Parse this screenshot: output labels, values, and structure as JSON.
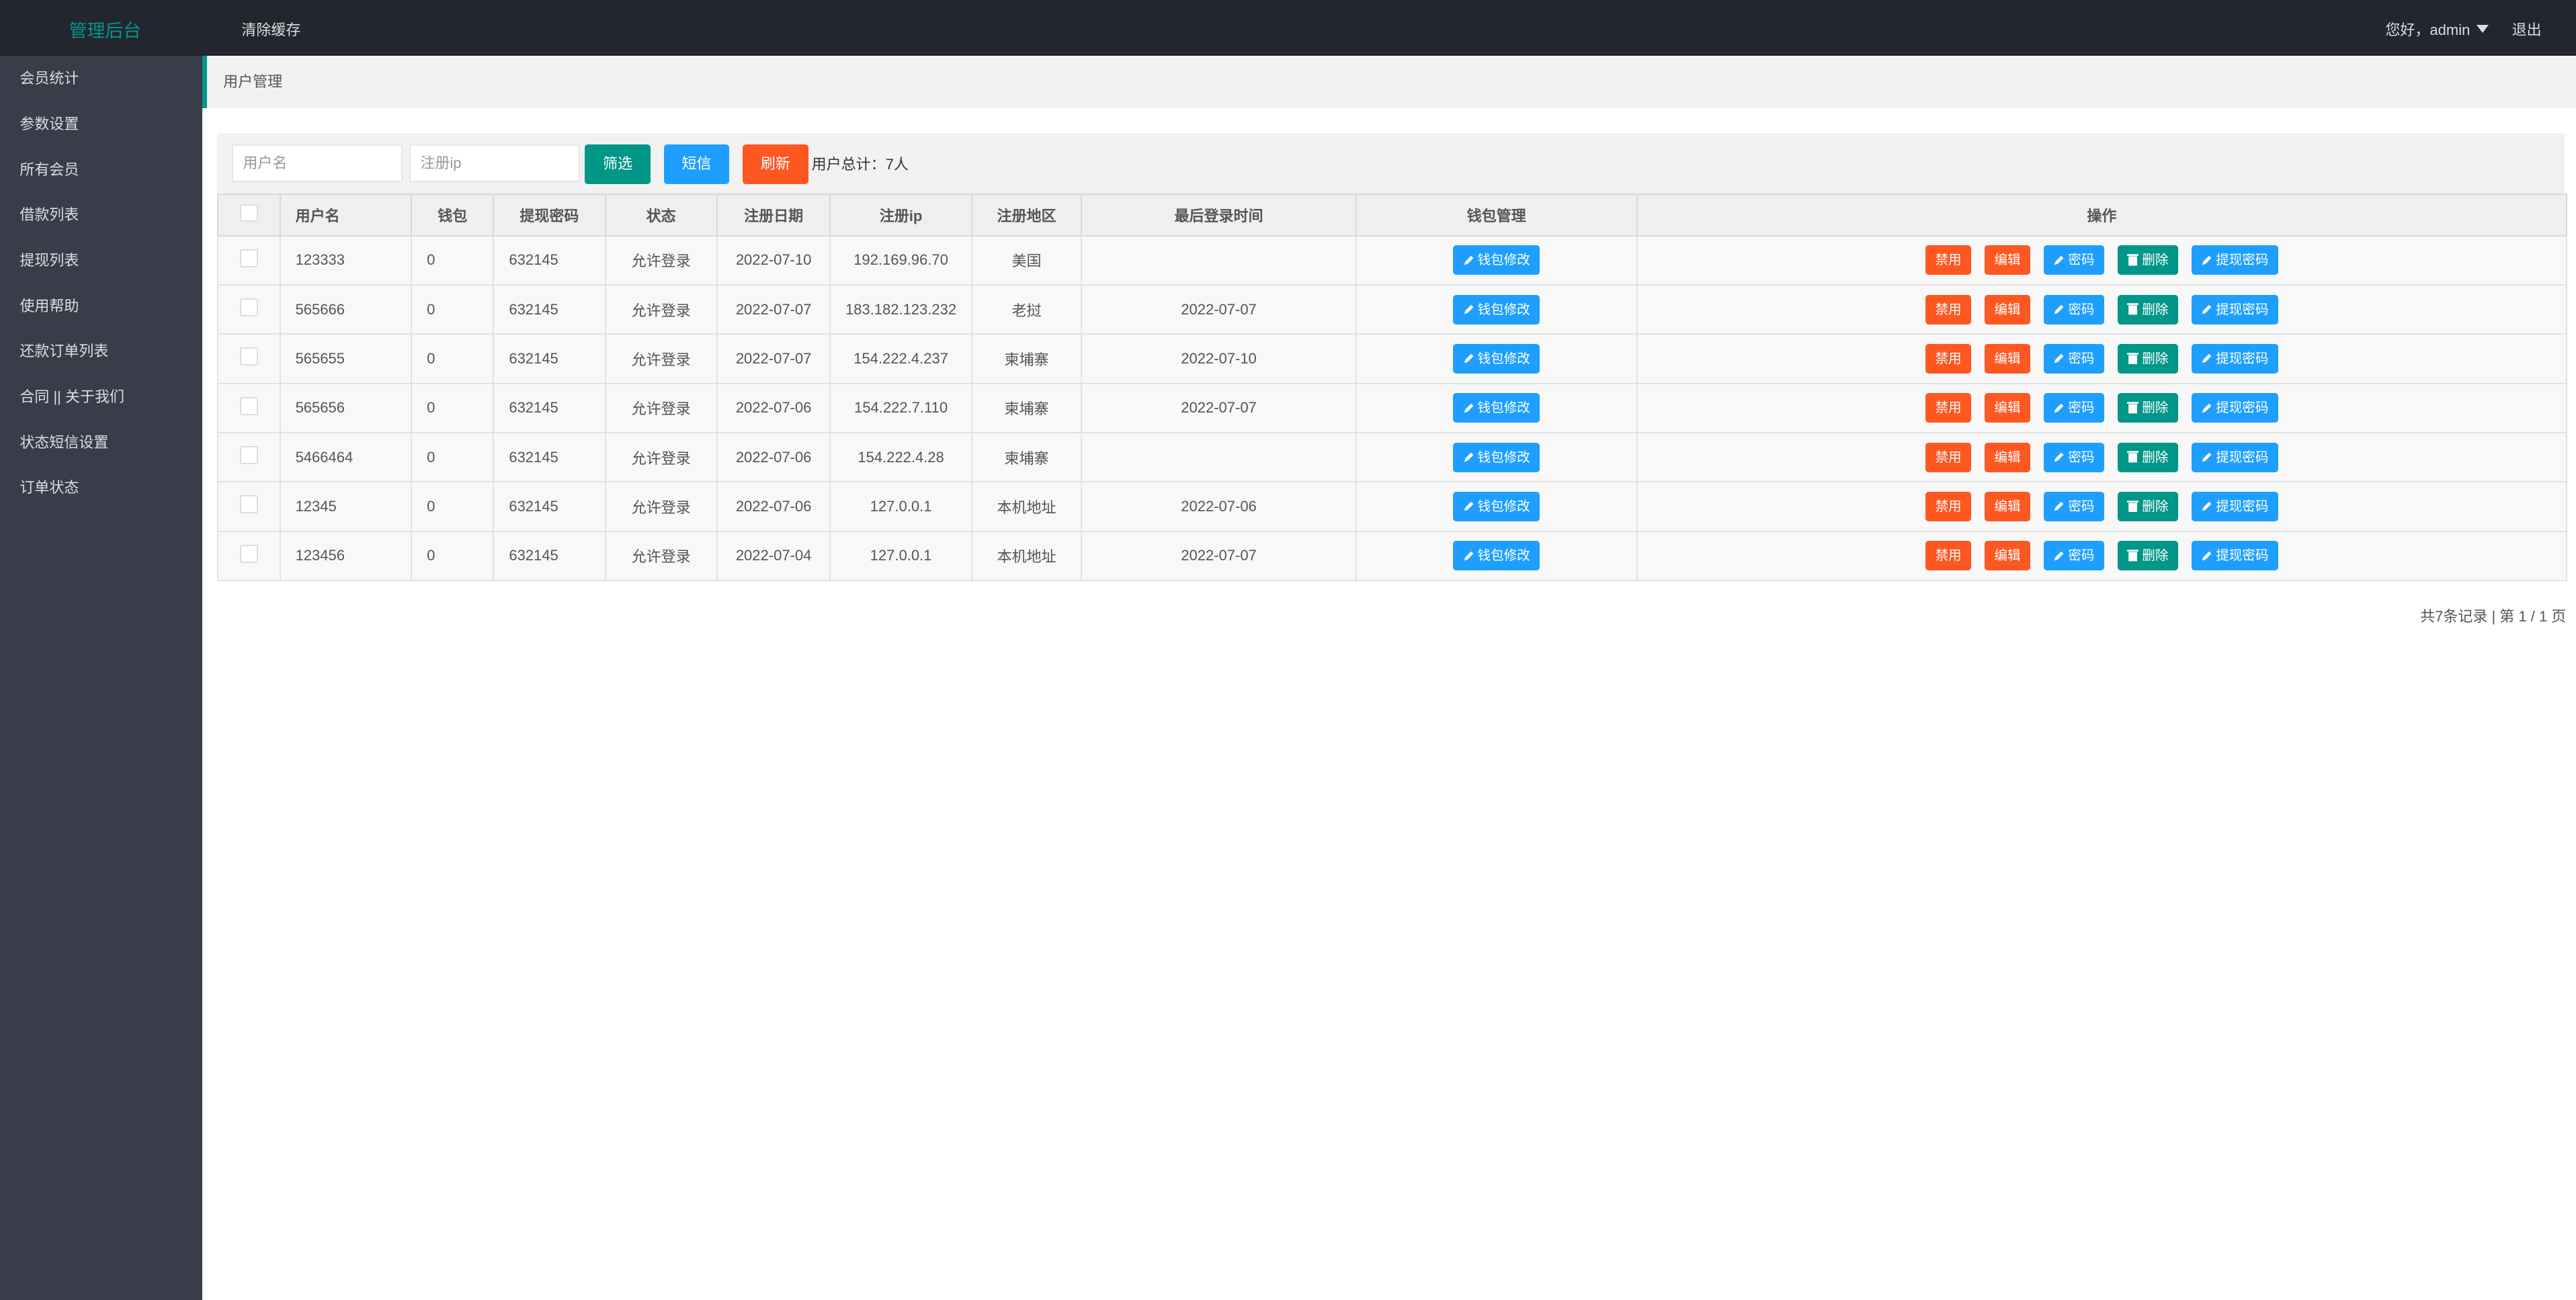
{
  "header": {
    "logo": "管理后台",
    "clear_cache": "清除缓存",
    "greeting": "您好，admin",
    "logout": "退出"
  },
  "sidebar": {
    "items": [
      "会员统计",
      "参数设置",
      "所有会员",
      "借款列表",
      "提现列表",
      "使用帮助",
      "还款订单列表",
      "合同 || 关于我们",
      "状态短信设置",
      "订单状态"
    ]
  },
  "breadcrumb": "用户管理",
  "toolbar": {
    "username_placeholder": "用户名",
    "ip_placeholder": "注册ip",
    "filter": "筛选",
    "sms": "短信",
    "refresh": "刷新",
    "total": "用户总计：7人"
  },
  "table": {
    "headers": [
      "用户名",
      "钱包",
      "提现密码",
      "状态",
      "注册日期",
      "注册ip",
      "注册地区",
      "最后登录时间",
      "钱包管理",
      "操作"
    ],
    "rows": [
      [
        "123333",
        "0",
        "632145",
        "允许登录",
        "2022-07-10",
        "192.169.96.70",
        "美国",
        ""
      ],
      [
        "565666",
        "0",
        "632145",
        "允许登录",
        "2022-07-07",
        "183.182.123.232",
        "老挝",
        "2022-07-07"
      ],
      [
        "565655",
        "0",
        "632145",
        "允许登录",
        "2022-07-07",
        "154.222.4.237",
        "柬埔寨",
        "2022-07-10"
      ],
      [
        "565656",
        "0",
        "632145",
        "允许登录",
        "2022-07-06",
        "154.222.7.110",
        "柬埔寨",
        "2022-07-07"
      ],
      [
        "5466464",
        "0",
        "632145",
        "允许登录",
        "2022-07-06",
        "154.222.4.28",
        "柬埔寨",
        ""
      ],
      [
        "12345",
        "0",
        "632145",
        "允许登录",
        "2022-07-06",
        "127.0.0.1",
        "本机地址",
        "2022-07-06"
      ],
      [
        "123456",
        "0",
        "632145",
        "允许登录",
        "2022-07-04",
        "127.0.0.1",
        "本机地址",
        "2022-07-07"
      ]
    ],
    "wallet_button": "钱包修改",
    "actions": {
      "disable": "禁用",
      "edit": "编辑",
      "password": "密码",
      "delete": "删除",
      "withdraw_password": "提现密码"
    }
  },
  "pagination": "共7条记录 | 第 1 / 1 页",
  "colors": {
    "teal": "#009688",
    "blue": "#1e9fff",
    "orange": "#ff5722",
    "topbar": "#23262e",
    "sidebar": "#393d49"
  }
}
